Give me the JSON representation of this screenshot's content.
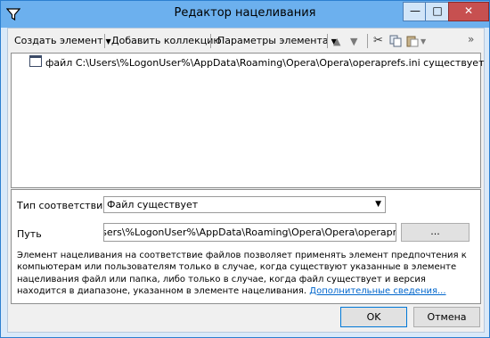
{
  "window": {
    "title": "Редактор нацеливания",
    "controls": {
      "minimize": "—",
      "maximize": "□",
      "close": "✕"
    }
  },
  "toolbar": {
    "create_element": "Создать элемент",
    "add_collection": "Добавить коллекцию",
    "element_params": "Параметры элемента",
    "overflow": "»"
  },
  "tree": {
    "item_text": "файл C:\\Users\\%LogonUser%\\AppData\\Roaming\\Opera\\Opera\\operaprefs.ini существует"
  },
  "props": {
    "match_type_label": "Тип соответствия",
    "match_type_value": "Файл существует",
    "path_label": "Путь",
    "path_value": "C:\\Users\\%LogonUser%\\AppData\\Roaming\\Opera\\Opera\\operaprefs.ini",
    "browse_label": "...",
    "description": "Элемент нацеливания на соответствие файлов позволяет применять элемент предпочтения к компьютерам или пользователям только в случае, когда существуют указанные в элементе нацеливания файл или папка, либо только в случае, когда файл существует и версия находится в диапазоне, указанном в элементе нацеливания.",
    "more_link": "Дополнительные сведения..."
  },
  "buttons": {
    "ok": "OK",
    "cancel": "Отмена"
  }
}
